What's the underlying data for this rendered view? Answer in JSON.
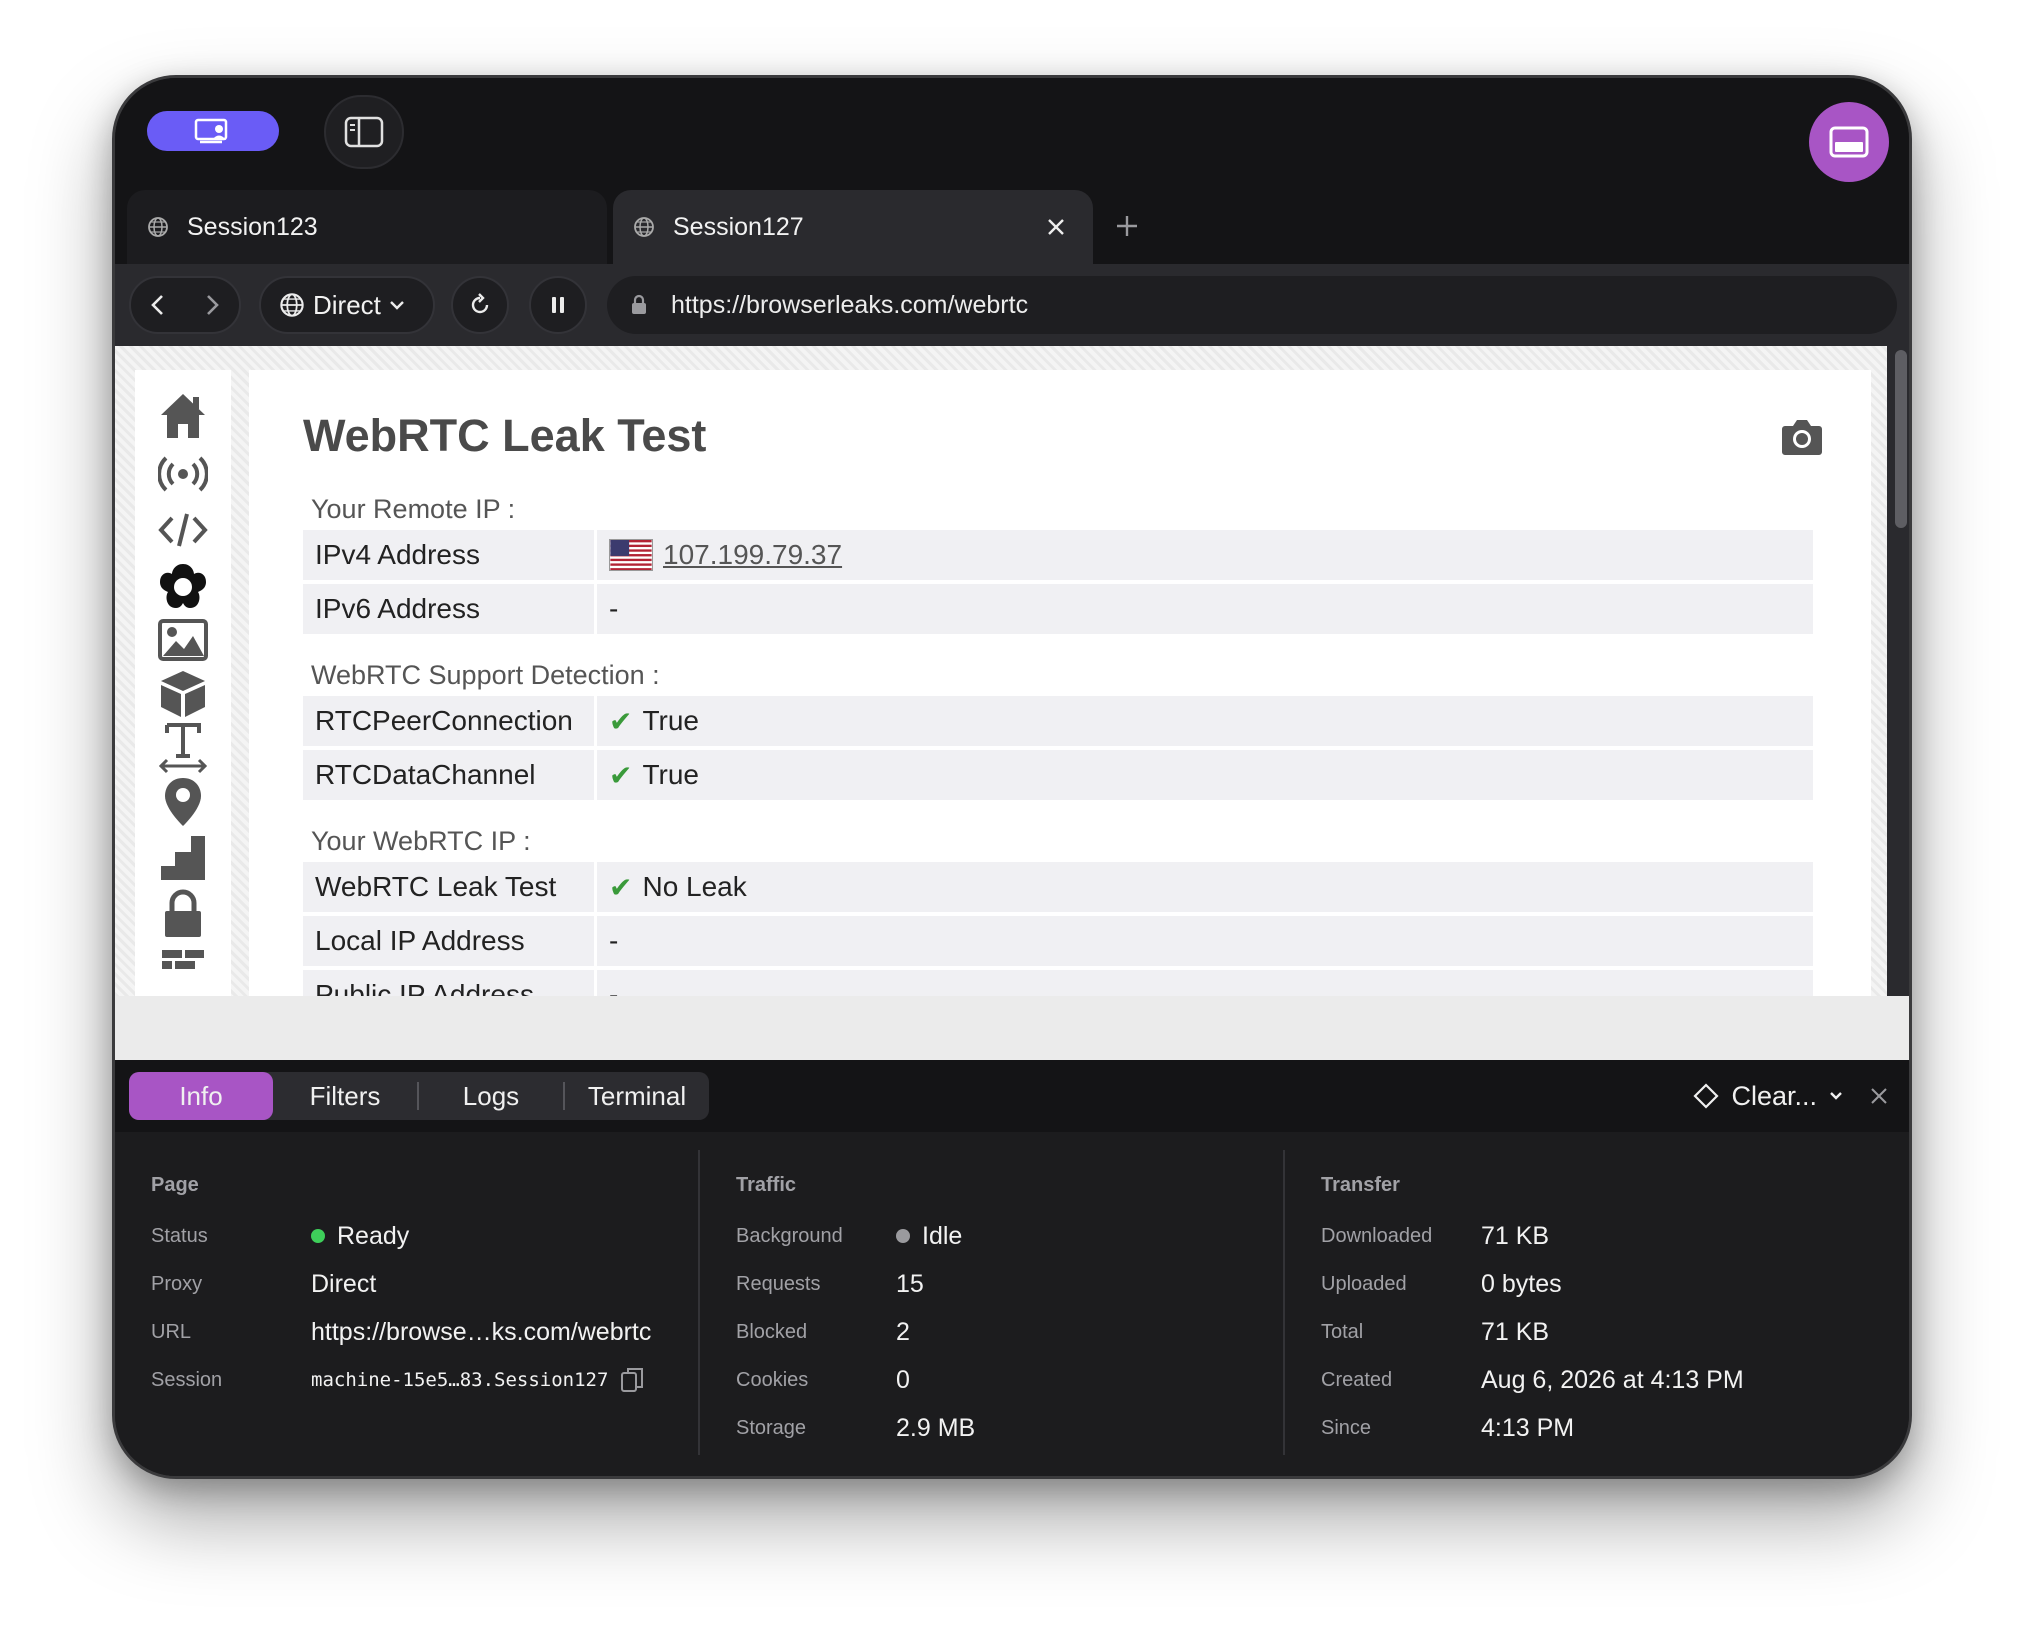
{
  "tabs": [
    {
      "label": "Session123"
    },
    {
      "label": "Session127"
    }
  ],
  "nav": {
    "proxy_label": "Direct",
    "url": "https://browserleaks.com/webrtc"
  },
  "page": {
    "title": "WebRTC Leak Test",
    "sections": {
      "remote_ip": "Your Remote IP :",
      "support": "WebRTC Support Detection :",
      "webrtc_ip": "Your WebRTC IP :"
    },
    "rows": {
      "ipv4_key": "IPv4 Address",
      "ipv4_val": "107.199.79.37",
      "ipv6_key": "IPv6 Address",
      "ipv6_val": "-",
      "peer_key": "RTCPeerConnection",
      "peer_val": "True",
      "data_key": "RTCDataChannel",
      "data_val": "True",
      "leak_key": "WebRTC Leak Test",
      "leak_val": "No Leak",
      "local_key": "Local IP Address",
      "local_val": "-",
      "public_key": "Public IP Address",
      "public_val": "-"
    }
  },
  "devtools": {
    "tabs": [
      "Info",
      "Filters",
      "Logs",
      "Terminal"
    ],
    "clear_label": "Clear...",
    "page": {
      "heading": "Page",
      "status_k": "Status",
      "status_v": "Ready",
      "proxy_k": "Proxy",
      "proxy_v": "Direct",
      "url_k": "URL",
      "url_v": "https://browse…ks.com/webrtc",
      "session_k": "Session",
      "session_v": "machine-15e5…83.Session127"
    },
    "traffic": {
      "heading": "Traffic",
      "background_k": "Background",
      "background_v": "Idle",
      "requests_k": "Requests",
      "requests_v": "15",
      "blocked_k": "Blocked",
      "blocked_v": "2",
      "cookies_k": "Cookies",
      "cookies_v": "0",
      "storage_k": "Storage",
      "storage_v": "2.9 MB"
    },
    "transfer": {
      "heading": "Transfer",
      "downloaded_k": "Downloaded",
      "downloaded_v": "71 KB",
      "uploaded_k": "Uploaded",
      "uploaded_v": "0 bytes",
      "total_k": "Total",
      "total_v": "71 KB",
      "created_k": "Created",
      "created_v": "Aug 6, 2026 at 4:13 PM",
      "since_k": "Since",
      "since_v": "4:13 PM"
    }
  },
  "colors": {
    "accent_purple": "#a855c5",
    "accent_indigo": "#6a5cf6",
    "status_ready": "#3ecf5a",
    "status_idle": "#9a9a9e",
    "check_green": "#3a9a3a"
  }
}
